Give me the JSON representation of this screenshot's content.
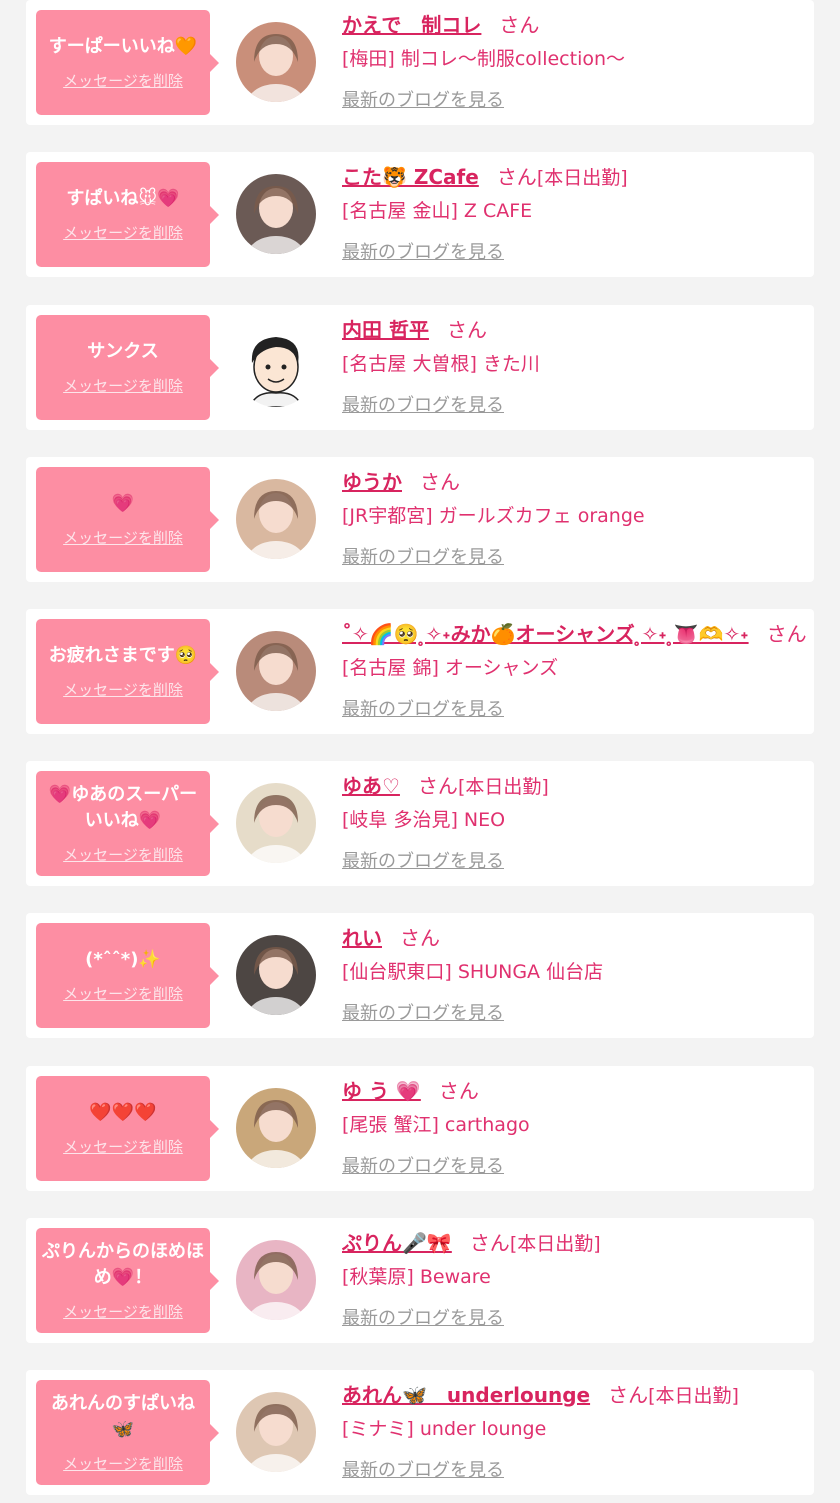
{
  "items": [
    {
      "message": "すーぱーいいね🧡",
      "delete_label": "メッセージを削除",
      "name": "かえで　制コレ",
      "san": "さん",
      "shukkin": "",
      "shop": "[梅田] 制コレ〜制服collection〜",
      "blog_label": "最新のブログを見る",
      "avatar_icon": "user-photo",
      "avatar_color": "#c98f7a"
    },
    {
      "message": "すぱいね🐭💗",
      "delete_label": "メッセージを削除",
      "name": "こた🐯 ZCafe",
      "san": "さん",
      "shukkin": "[本日出勤]",
      "shop": "[名古屋 金山] Z CAFE",
      "blog_label": "最新のブログを見る",
      "avatar_icon": "user-photo",
      "avatar_color": "#6b5a55"
    },
    {
      "message": "サンクス",
      "delete_label": "メッセージを削除",
      "name": "内田 哲平",
      "san": "さん",
      "shukkin": "",
      "shop": "[名古屋 大曽根] きた川",
      "blog_label": "最新のブログを見る",
      "avatar_icon": "cartoon-user-illustration",
      "avatar_color": "#ffffff"
    },
    {
      "message": "💗",
      "delete_label": "メッセージを削除",
      "name": "ゆうか",
      "san": "さん",
      "shukkin": "",
      "shop": "[JR宇都宮] ガールズカフェ orange",
      "blog_label": "最新のブログを見る",
      "avatar_icon": "user-photo",
      "avatar_color": "#d9b8a0"
    },
    {
      "message": "お疲れさまです🥺",
      "delete_label": "メッセージを削除",
      "name": "˚✧🌈🥺 ̥✧˖みか🍊オーシャンズ ̥✧˖ ̥👅🫶✧˖",
      "san": "さん",
      "shukkin": "",
      "shop": "[名古屋 錦] オーシャンズ",
      "blog_label": "最新のブログを見る",
      "avatar_icon": "user-photo",
      "avatar_color": "#b98b7a"
    },
    {
      "message": "💗ゆあのスーパーいいね💗",
      "delete_label": "メッセージを削除",
      "name": "ゆあ♡",
      "san": "さん",
      "shukkin": "[本日出勤]",
      "shop": "[岐阜 多治見] NEO",
      "blog_label": "最新のブログを見る",
      "avatar_icon": "user-photo",
      "avatar_color": "#e6dcc9"
    },
    {
      "message": "(*ˆˆ*)✨",
      "delete_label": "メッセージを削除",
      "name": "れい",
      "san": "さん",
      "shukkin": "",
      "shop": "[仙台駅東口] SHUNGA 仙台店",
      "blog_label": "最新のブログを見る",
      "avatar_icon": "user-photo",
      "avatar_color": "#4d4643"
    },
    {
      "message": "❤️❤️❤️",
      "delete_label": "メッセージを削除",
      "name": "ゆ う 💗",
      "san": "さん",
      "shukkin": "",
      "shop": "[尾張 蟹江] carthago",
      "blog_label": "最新のブログを見る",
      "avatar_icon": "user-photo",
      "avatar_color": "#c9a77a"
    },
    {
      "message": "ぷりんからのほめほめ💗！",
      "delete_label": "メッセージを削除",
      "name": "ぷりん🎤🎀",
      "san": "さん",
      "shukkin": "[本日出勤]",
      "shop": "[秋葉原] Beware",
      "blog_label": "最新のブログを見る",
      "avatar_icon": "user-photo",
      "avatar_color": "#e8b5c4"
    },
    {
      "message": "あれんのすぱいね🦋",
      "delete_label": "メッセージを削除",
      "name": "あれん🦋　underlounge",
      "san": "さん",
      "shukkin": "[本日出勤]",
      "shop": "[ミナミ] under lounge",
      "blog_label": "最新のブログを見る",
      "avatar_icon": "user-photo",
      "avatar_color": "#dec7b3"
    }
  ]
}
